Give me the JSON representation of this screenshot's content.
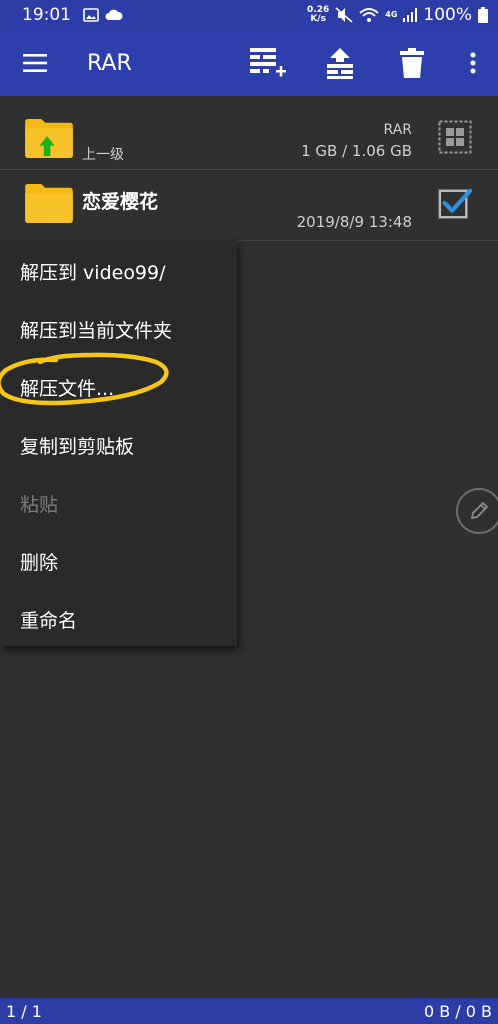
{
  "status_bar": {
    "time": "19:01",
    "net_speed_value": "0.26",
    "net_speed_unit": "K/s",
    "network_label": "4G",
    "battery": "100%"
  },
  "app_bar": {
    "title": "RAR",
    "icons": [
      "menu-icon",
      "add-to-archive-icon",
      "extract-icon",
      "trash-icon",
      "more-vert-icon"
    ]
  },
  "file_list": {
    "parent_row": {
      "label": "上一级",
      "archive_type": "RAR",
      "size": "1 GB / 1.06 GB"
    },
    "items": [
      {
        "name": "恋爱樱花",
        "date": "2019/8/9 13:48",
        "selected": true
      }
    ]
  },
  "context_menu": {
    "items": [
      {
        "label": "解压到 video99/",
        "enabled": true
      },
      {
        "label": "解压到当前文件夹",
        "enabled": true
      },
      {
        "label": "解压文件...",
        "enabled": true
      },
      {
        "label": "复制到剪贴板",
        "enabled": true
      },
      {
        "label": "粘贴",
        "enabled": false
      },
      {
        "label": "删除",
        "enabled": true
      },
      {
        "label": "重命名",
        "enabled": true
      }
    ]
  },
  "colors": {
    "primary": "#2e3fab",
    "background": "#303030",
    "folder": "#f5b914",
    "check": "#2f8fe0",
    "highlight_circle": "#f5c518"
  },
  "bottom_bar": {
    "count": "1 / 1",
    "size": "0 B / 0 B"
  }
}
